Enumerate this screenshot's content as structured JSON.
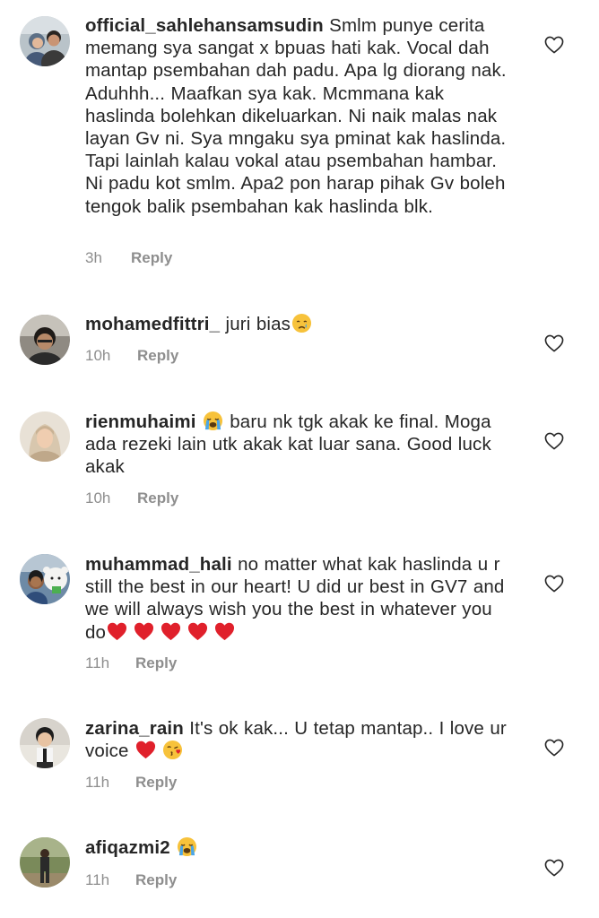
{
  "reply_label": "Reply",
  "colors": {
    "text": "#262626",
    "secondary": "#8e8e8e",
    "heart_red": "#e0202b",
    "emoji_yellow": "#f7c23b"
  },
  "comments": [
    {
      "username": "official_sahlehansamsudin",
      "text": " Smlm punye cerita memang sya sangat x bpuas hati kak. Vocal dah mantap psembahan dah padu. Apa lg diorang nak. Aduhhh... Maafkan sya kak. Mcmmana kak haslinda bolehkan dikeluarkan. Ni naik malas nak layan Gv ni. Sya mngaku sya pminat kak haslinda. Tapi lainlah kalau vokal atau psembahan hambar. Ni padu kot smlm. Apa2 pon harap pihak Gv boleh tengok balik psembahan kak haslinda blk.",
      "time": "3h",
      "emojis": []
    },
    {
      "username": "mohamedfittri_",
      "text": " juri bias",
      "time": "10h",
      "emojis": [
        "crying-face"
      ]
    },
    {
      "username": "rienmuhaimi",
      "text": " baru nk tgk akak ke final. Moga ada rezeki lain utk akak kat luar sana. Good luck akak",
      "time": "10h",
      "emojis": [
        "loudly-crying-face"
      ]
    },
    {
      "username": "muhammad_hali",
      "text": " no matter what kak haslinda u r still the best in our heart! U did ur best in GV7 and we will always wish you the best in whatever you do",
      "time": "11h",
      "emojis": [
        "red-heart",
        "red-heart",
        "red-heart",
        "red-heart",
        "red-heart"
      ]
    },
    {
      "username": "zarina_rain",
      "text": " It's ok kak... U tetap mantap.. I love ur voice ",
      "time": "11h",
      "emojis": [
        "red-heart",
        "face-blowing-kiss"
      ]
    },
    {
      "username": "afiqazmi2",
      "text": " ",
      "time": "11h",
      "emojis": [
        "loudly-crying-face"
      ]
    }
  ]
}
